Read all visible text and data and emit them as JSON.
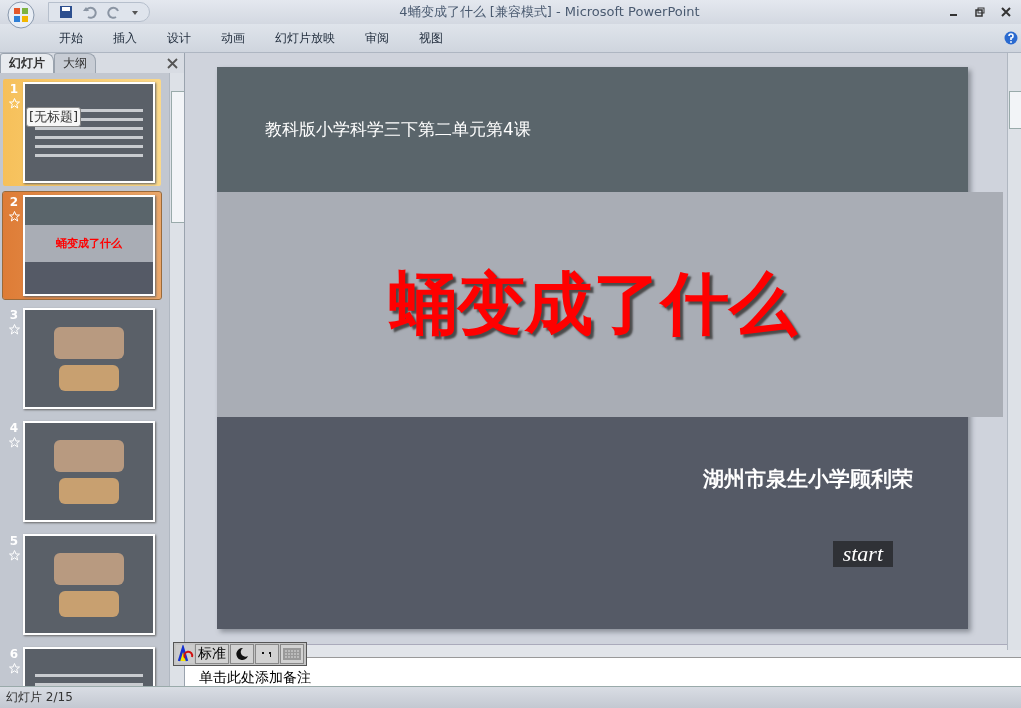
{
  "window": {
    "title": "4蛹变成了什么 [兼容模式] - Microsoft PowerPoint"
  },
  "ribbon_tabs": [
    {
      "label": "开始",
      "selected": false
    },
    {
      "label": "插入",
      "selected": false
    },
    {
      "label": "设计",
      "selected": false
    },
    {
      "label": "动画",
      "selected": false
    },
    {
      "label": "幻灯片放映",
      "selected": false
    },
    {
      "label": "审阅",
      "selected": false
    },
    {
      "label": "视图",
      "selected": false
    }
  ],
  "pane_tabs": [
    {
      "label": "幻灯片",
      "selected": true
    },
    {
      "label": "大纲",
      "selected": false
    }
  ],
  "slides": [
    {
      "number": "1",
      "kind": "content",
      "selected": false,
      "hover": true,
      "tooltip": "[无标题]"
    },
    {
      "number": "2",
      "kind": "title",
      "selected": true,
      "hover": false,
      "title": "蛹变成了什么"
    },
    {
      "number": "3",
      "kind": "photos",
      "selected": false,
      "hover": false
    },
    {
      "number": "4",
      "kind": "photos",
      "selected": false,
      "hover": false
    },
    {
      "number": "5",
      "kind": "photos",
      "selected": false,
      "hover": false
    },
    {
      "number": "6",
      "kind": "content",
      "selected": false,
      "hover": false
    }
  ],
  "slide": {
    "course": "教科版小学科学三下第二单元第4课",
    "title": "蛹变成了什么",
    "author": "湖州市泉生小学顾利荣",
    "button": "start"
  },
  "notes": {
    "prompt": "单击此处添加备注"
  },
  "ime": {
    "mode": "标准"
  },
  "status_bar": {
    "slide_counter": "幻灯片 2/15"
  }
}
